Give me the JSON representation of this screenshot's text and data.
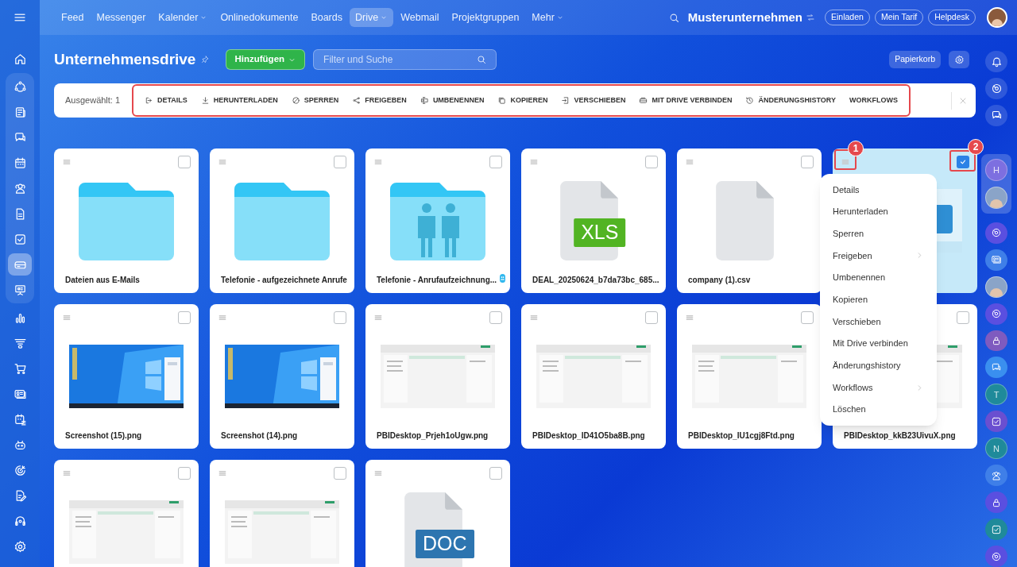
{
  "topbar": {
    "nav": [
      {
        "label": "Feed",
        "selected": false,
        "dropdown": false
      },
      {
        "label": "Messenger",
        "selected": false,
        "dropdown": false
      },
      {
        "label": "Kalender",
        "selected": false,
        "dropdown": true
      },
      {
        "label": "Onlinedokumente",
        "selected": false,
        "dropdown": false
      },
      {
        "label": "Boards",
        "selected": false,
        "dropdown": false
      },
      {
        "label": "Drive",
        "selected": true,
        "dropdown": true
      },
      {
        "label": "Webmail",
        "selected": false,
        "dropdown": false
      },
      {
        "label": "Projektgruppen",
        "selected": false,
        "dropdown": false
      },
      {
        "label": "Mehr",
        "selected": false,
        "dropdown": true
      }
    ],
    "company": "Musterunternehmen",
    "buttons": [
      "Einladen",
      "Mein Tarif",
      "Helpdesk"
    ]
  },
  "left_sidebar": {
    "top": [
      {
        "selected": false
      }
    ],
    "group": [
      {
        "selected": false
      },
      {
        "selected": false
      },
      {
        "selected": false
      },
      {
        "selected": false
      },
      {
        "selected": false
      },
      {
        "selected": false
      },
      {
        "selected": false
      },
      {
        "selected": true
      },
      {
        "selected": false
      }
    ],
    "bottom": [
      {
        "selected": false
      },
      {
        "selected": false
      },
      {
        "selected": false
      },
      {
        "selected": false
      },
      {
        "selected": false
      },
      {
        "selected": false
      },
      {
        "selected": false
      },
      {
        "selected": false
      },
      {
        "selected": false
      },
      {
        "selected": false
      }
    ]
  },
  "page": {
    "title": "Unternehmensdrive",
    "add_button": "Hinzufügen",
    "search": {
      "placeholder": "Filter und Suche"
    },
    "trash_button": "Papierkorb"
  },
  "action_bar": {
    "selected_count": "Ausgewählt: 1",
    "actions": [
      "DETAILS",
      "HERUNTERLADEN",
      "SPERREN",
      "FREIGEBEN",
      "UMBENENNEN",
      "KOPIEREN",
      "VERSCHIEBEN",
      "MIT DRIVE VERBINDEN",
      "ÄNDERUNGSHISTORY",
      "WORKFLOWS"
    ]
  },
  "files": [
    {
      "name": "Dateien aus E-Mails",
      "kind": "folder",
      "selected": false
    },
    {
      "name": "Telefonie - aufgezeichnete Anrufe",
      "kind": "folder",
      "selected": false
    },
    {
      "name": "Telefonie - Anrufaufzeichnung...",
      "kind": "shared_folder",
      "selected": false,
      "shared": true
    },
    {
      "name": "DEAL_20250624_b7da73bc_685...",
      "kind": "xls",
      "badge": "XLS",
      "selected": false
    },
    {
      "name": "company (1).csv",
      "kind": "file",
      "selected": false
    },
    {
      "kind": "picture",
      "selected": true
    },
    {
      "name": "Screenshot (15).png",
      "kind": "desktop",
      "selected": false
    },
    {
      "name": "Screenshot (14).png",
      "kind": "desktop",
      "selected": false
    },
    {
      "name": "PBIDesktop_Prjeh1oUgw.png",
      "kind": "app",
      "selected": false
    },
    {
      "name": "PBIDesktop_ID41O5ba8B.png",
      "kind": "app",
      "selected": false
    },
    {
      "name": "PBIDesktop_IU1cgj8Ftd.png",
      "kind": "app",
      "selected": false
    },
    {
      "name": "PBIDesktop_kkB23UivuX.png",
      "kind": "app",
      "selected": false
    },
    {
      "kind": "app",
      "selected": false
    },
    {
      "kind": "app",
      "selected": false
    },
    {
      "kind": "doc",
      "badge": "DOC",
      "selected": false
    }
  ],
  "context_menu": {
    "items": [
      {
        "label": "Details",
        "submenu": false
      },
      {
        "label": "Herunterladen",
        "submenu": false
      },
      {
        "label": "Sperren",
        "submenu": false
      },
      {
        "label": "Freigeben",
        "submenu": true
      },
      {
        "label": "Umbenennen",
        "submenu": false
      },
      {
        "label": "Kopieren",
        "submenu": false
      },
      {
        "label": "Verschieben",
        "submenu": false
      },
      {
        "label": "Mit Drive verbinden",
        "submenu": false
      },
      {
        "label": "Änderungshistory",
        "submenu": false
      },
      {
        "label": "Workflows",
        "submenu": true
      },
      {
        "label": "Löschen",
        "submenu": false
      }
    ]
  },
  "annotations": [
    "1",
    "2"
  ],
  "right_rail": {
    "top": [
      {
        "kind": "icon"
      },
      {
        "kind": "icon"
      },
      {
        "kind": "icon"
      }
    ],
    "panel": [
      {
        "kind": "letter",
        "text": "H",
        "color": "#7d6fe0"
      },
      {
        "kind": "avatar"
      }
    ],
    "items": [
      {
        "kind": "icon",
        "color": "#5a4fe0"
      },
      {
        "kind": "icon",
        "color": "#3f7fe8"
      },
      {
        "kind": "avatar"
      },
      {
        "kind": "icon",
        "color": "#5a4fe0"
      },
      {
        "kind": "icon",
        "color": "#7f5bbf"
      },
      {
        "kind": "icon",
        "color": "#3a8fef"
      },
      {
        "kind": "letter",
        "text": "T",
        "color": "#1f8a9a"
      },
      {
        "kind": "icon",
        "color": "#6a4fd0"
      },
      {
        "kind": "letter",
        "text": "N",
        "color": "#1f8a9a"
      },
      {
        "kind": "icon",
        "color": "#3f7fe8"
      },
      {
        "kind": "icon",
        "color": "#5a4fe0"
      },
      {
        "kind": "icon",
        "color": "#1f8a9a"
      },
      {
        "kind": "icon",
        "color": "#5a4fe0"
      }
    ]
  }
}
